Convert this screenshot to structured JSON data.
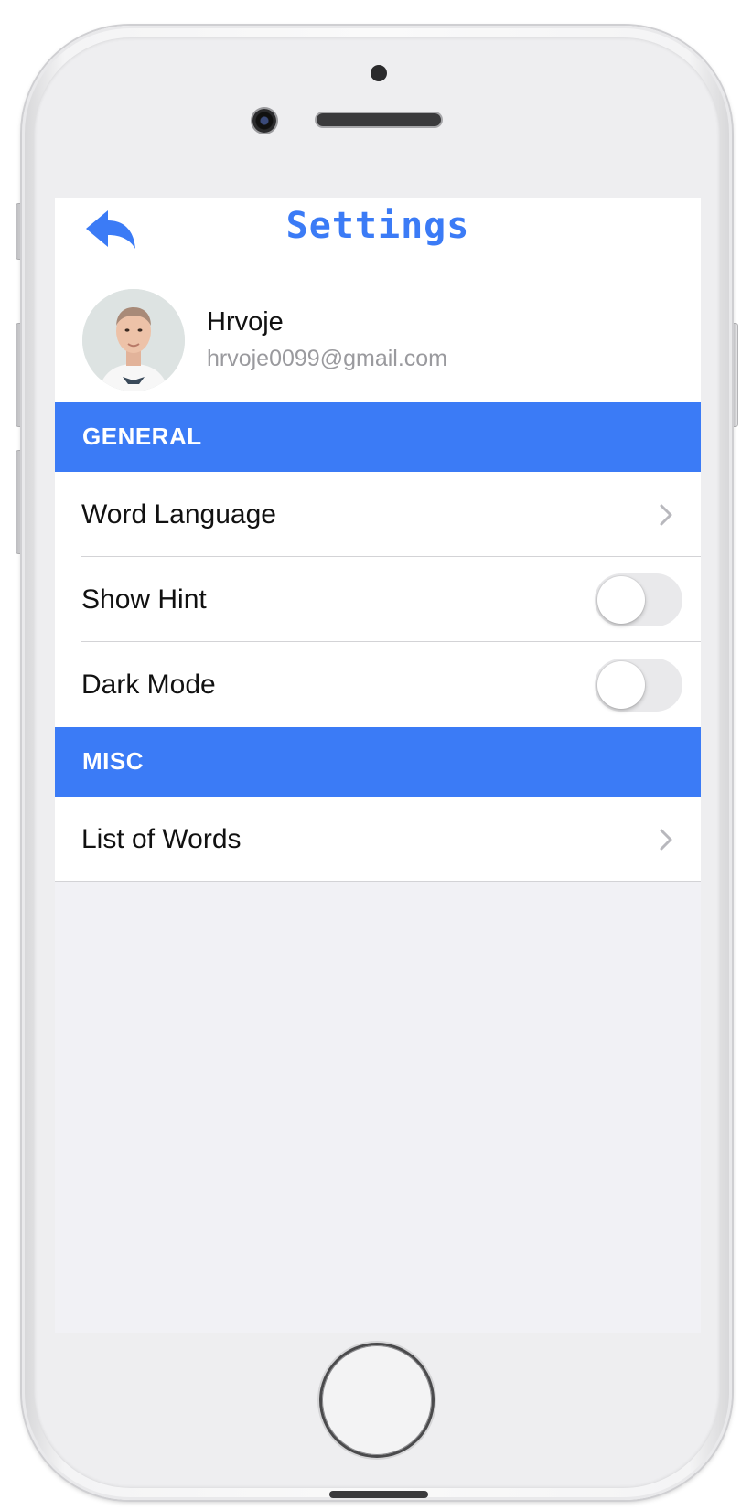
{
  "navbar": {
    "title": "Settings",
    "back_icon": "reply-arrow-icon"
  },
  "profile": {
    "name": "Hrvoje",
    "email": "hrvoje0099@gmail.com"
  },
  "sections": {
    "general": {
      "header": "GENERAL",
      "word_language": {
        "label": "Word Language"
      },
      "show_hint": {
        "label": "Show Hint",
        "enabled": false
      },
      "dark_mode": {
        "label": "Dark Mode",
        "enabled": false
      }
    },
    "misc": {
      "header": "MISC",
      "list_of_words": {
        "label": "List of Words"
      }
    }
  },
  "colors": {
    "accent": "#3b7bf6",
    "background": "#f1f1f5",
    "toggle_off": "#e9e9eb"
  }
}
